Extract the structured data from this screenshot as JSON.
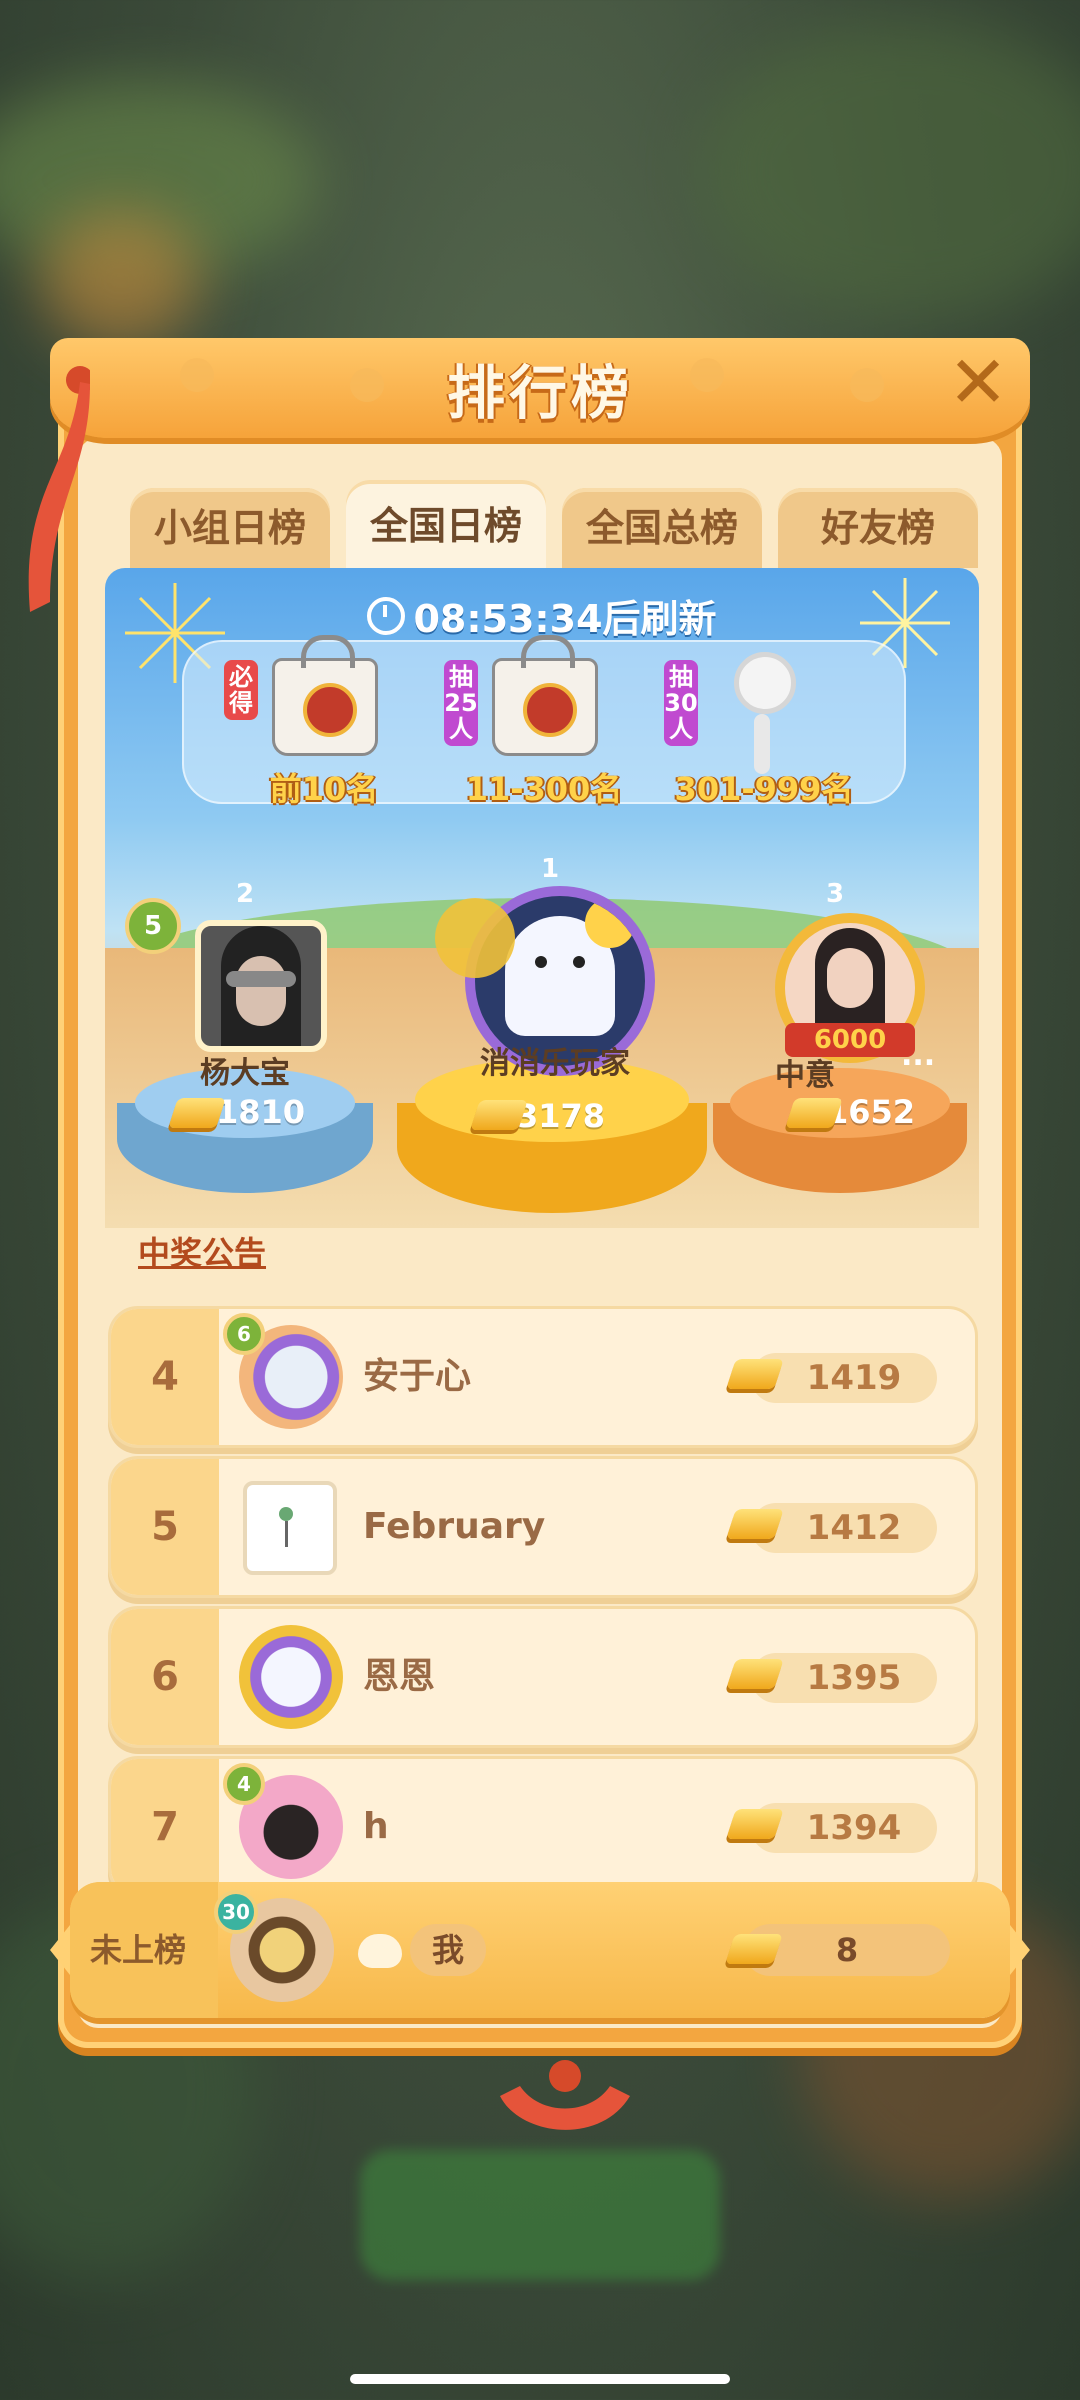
{
  "header": {
    "title": "排行榜",
    "close_icon": "close-icon"
  },
  "tabs": [
    {
      "label": "小组日榜",
      "active": false
    },
    {
      "label": "全国日榜",
      "active": true
    },
    {
      "label": "全国总榜",
      "active": false
    },
    {
      "label": "好友榜",
      "active": false
    }
  ],
  "countdown": {
    "time": "08:53:34",
    "suffix": "后刷新"
  },
  "prizes": [
    {
      "tag": "必得",
      "label": "前10名",
      "item": "bag",
      "tag_color": "#e84a4a"
    },
    {
      "tag": "抽25人",
      "label": "11-300名",
      "item": "bag",
      "tag_color": "#c04ad0"
    },
    {
      "tag": "抽30人",
      "label": "301-999名",
      "item": "fan",
      "tag_color": "#c04ad0"
    }
  ],
  "podium": [
    {
      "rank": "2",
      "name": "杨大宝",
      "score": "1810",
      "level": "5"
    },
    {
      "rank": "1",
      "name": "消消乐玩家",
      "score": "3178"
    },
    {
      "rank": "3",
      "name": "中意",
      "name_suffix": "...",
      "score": "1652",
      "frame_badge": "6000"
    }
  ],
  "announcement": "中奖公告",
  "rank_list": [
    {
      "rank": "4",
      "name": "安于心",
      "score": "1419",
      "level": "6"
    },
    {
      "rank": "5",
      "name": "February",
      "score": "1412"
    },
    {
      "rank": "6",
      "name": "恩恩",
      "score": "1395"
    },
    {
      "rank": "7",
      "name": "h",
      "score": "1394",
      "level": "4"
    }
  ],
  "me": {
    "status": "未上榜",
    "level": "30",
    "name": "我",
    "score": "8"
  },
  "colors": {
    "accent": "#f3a640",
    "gold": "#f0a81c",
    "sky": "#59a6ea"
  }
}
